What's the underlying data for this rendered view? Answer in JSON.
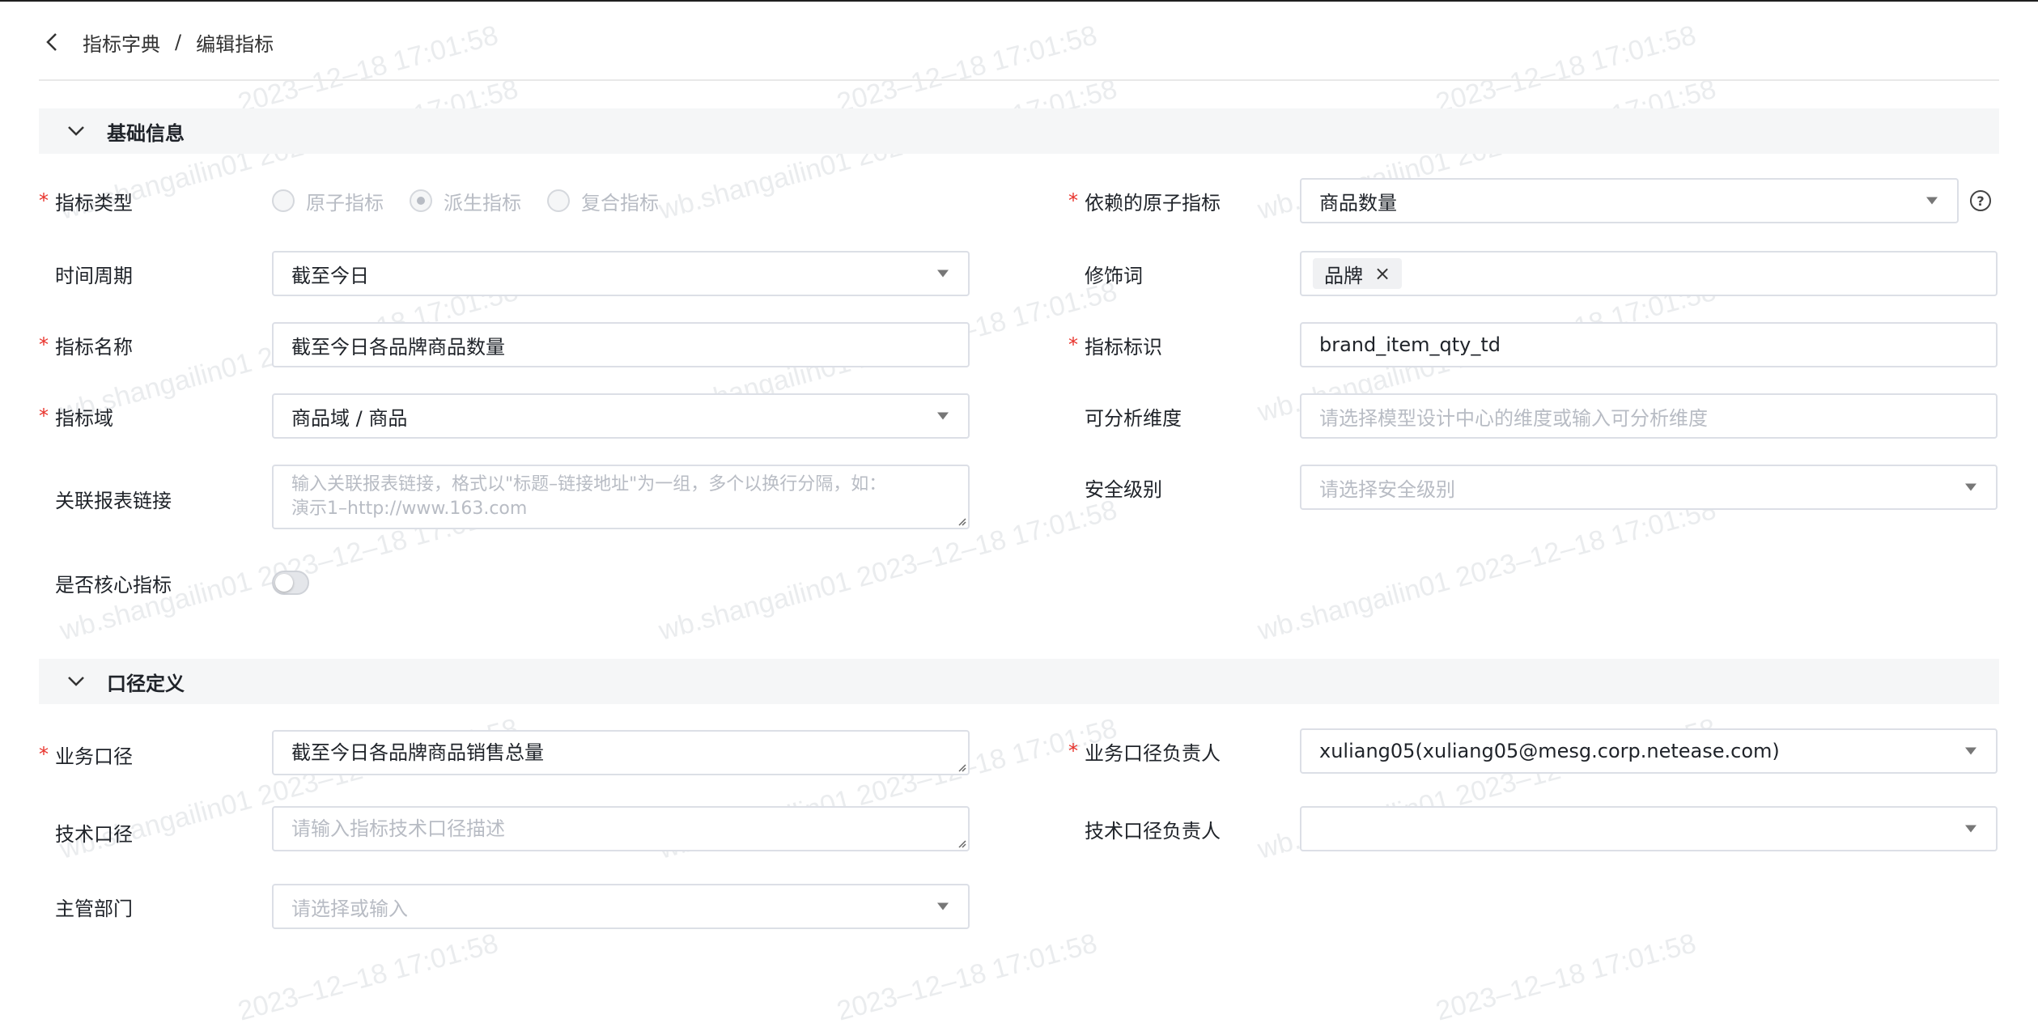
{
  "breadcrumb": {
    "parent": "指标字典",
    "separator": "/",
    "current": "编辑指标"
  },
  "sections": {
    "basic": "基础信息",
    "caliber": "口径定义"
  },
  "basic": {
    "metric_type": {
      "label": "指标类型",
      "options": [
        "原子指标",
        "派生指标",
        "复合指标"
      ],
      "selected": "派生指标"
    },
    "depends_on": {
      "label": "依赖的原子指标",
      "value": "商品数量"
    },
    "time_period": {
      "label": "时间周期",
      "value": "截至今日"
    },
    "modifier": {
      "label": "修饰词",
      "tag": "品牌"
    },
    "metric_name": {
      "label": "指标名称",
      "value": "截至今日各品牌商品数量"
    },
    "metric_code": {
      "label": "指标标识",
      "value": "brand_item_qty_td"
    },
    "domain": {
      "label": "指标域",
      "value": "商品域 / 商品"
    },
    "dimensions": {
      "label": "可分析维度",
      "placeholder": "请选择模型设计中心的维度或输入可分析维度"
    },
    "report_link": {
      "label": "关联报表链接",
      "placeholder_line1": "输入关联报表链接，格式以\"标题–链接地址\"为一组，多个以换行分隔，如：",
      "placeholder_line2": "演示1–http://www.163.com"
    },
    "security": {
      "label": "安全级别",
      "placeholder": "请选择安全级别"
    },
    "core": {
      "label": "是否核心指标",
      "on": false
    }
  },
  "caliber": {
    "business": {
      "label": "业务口径",
      "value": "截至今日各品牌商品销售总量"
    },
    "business_owner": {
      "label": "业务口径负责人",
      "value": "xuliang05(xuliang05@mesg.corp.netease.com)"
    },
    "technical": {
      "label": "技术口径",
      "placeholder": "请输入指标技术口径描述"
    },
    "technical_owner": {
      "label": "技术口径负责人",
      "value": ""
    },
    "department": {
      "label": "主管部门",
      "placeholder": "请选择或输入"
    }
  },
  "watermark": {
    "full": "wb.shangailin01 2023–12–18 17:01:58",
    "date": "2023–12–18 17:01:58"
  },
  "colors": {
    "required": "#e8322b",
    "border": "#dcdfe6",
    "placeholder": "#b8bcc4",
    "section_bg": "#f5f6f7"
  }
}
